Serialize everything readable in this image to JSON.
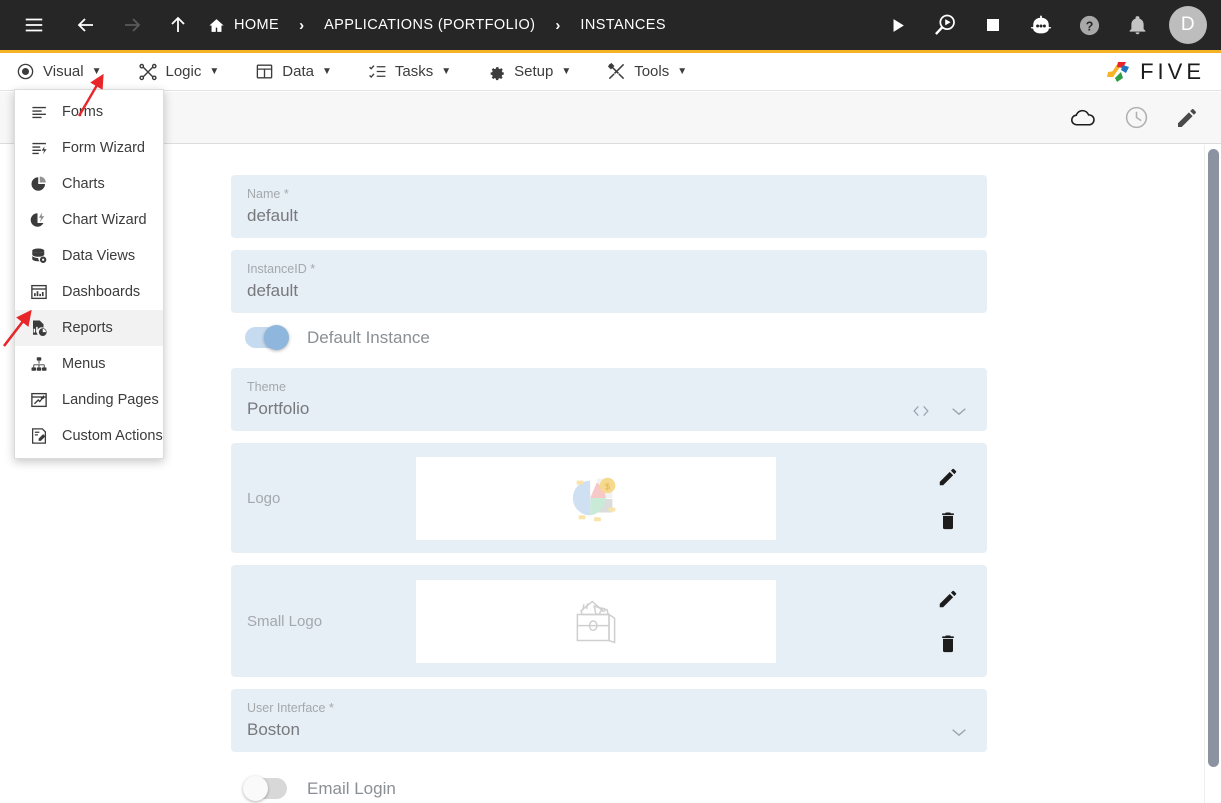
{
  "topbar": {
    "menu_icon": "hamburger-icon",
    "back_icon": "arrow-left-icon",
    "forward_icon": "arrow-right-icon",
    "up_icon": "arrow-up-icon",
    "breadcrumbs": [
      {
        "label": "HOME",
        "icon": "home-icon"
      },
      {
        "label": "APPLICATIONS (PORTFOLIO)",
        "icon": ""
      },
      {
        "label": "INSTANCES",
        "icon": ""
      }
    ],
    "separator": "›",
    "actions": [
      {
        "name": "run-icon"
      },
      {
        "name": "debug-icon"
      },
      {
        "name": "stop-icon"
      },
      {
        "name": "bot-icon"
      },
      {
        "name": "help-icon"
      },
      {
        "name": "notifications-icon"
      }
    ],
    "avatar_initial": "D",
    "background": "#262626",
    "accent_rule": "#f5b325"
  },
  "menubar": {
    "items": [
      {
        "label": "Visual",
        "icon": "eye-icon",
        "caret": "▼"
      },
      {
        "label": "Logic",
        "icon": "logic-icon",
        "caret": "▼"
      },
      {
        "label": "Data",
        "icon": "table-icon",
        "caret": "▼"
      },
      {
        "label": "Tasks",
        "icon": "tasks-icon",
        "caret": "▼"
      },
      {
        "label": "Setup",
        "icon": "gear-icon",
        "caret": "▼"
      },
      {
        "label": "Tools",
        "icon": "tools-icon",
        "caret": "▼"
      }
    ],
    "brand": {
      "text": "FIVE",
      "icon": "five-logo-icon"
    }
  },
  "dropdown": {
    "open_for": "Visual",
    "items": [
      {
        "label": "Forms",
        "icon": "forms-icon",
        "hovered": false
      },
      {
        "label": "Form Wizard",
        "icon": "form-wizard-icon",
        "hovered": false
      },
      {
        "label": "Charts",
        "icon": "charts-icon",
        "hovered": false
      },
      {
        "label": "Chart Wizard",
        "icon": "chart-wizard-icon",
        "hovered": false
      },
      {
        "label": "Data Views",
        "icon": "data-views-icon",
        "hovered": false
      },
      {
        "label": "Dashboards",
        "icon": "dashboards-icon",
        "hovered": false
      },
      {
        "label": "Reports",
        "icon": "reports-icon",
        "hovered": true
      },
      {
        "label": "Menus",
        "icon": "menus-icon",
        "hovered": false
      },
      {
        "label": "Landing Pages",
        "icon": "landing-pages-icon",
        "hovered": false
      },
      {
        "label": "Custom Actions",
        "icon": "custom-actions-icon",
        "hovered": false
      }
    ]
  },
  "subtoolbar": {
    "actions": [
      {
        "name": "cloud-icon"
      },
      {
        "name": "history-clock-icon"
      },
      {
        "name": "edit-pencil-icon"
      }
    ]
  },
  "form": {
    "fields": [
      {
        "label": "Name *",
        "value": "default",
        "type": "text"
      },
      {
        "label": "InstanceID *",
        "value": "default",
        "type": "text"
      }
    ],
    "default_instance": {
      "label": "Default Instance",
      "on": true
    },
    "theme": {
      "label": "Theme",
      "value": "Portfolio",
      "code_icon": "‹›",
      "chevron": "chevron-down-icon"
    },
    "logo": {
      "label": "Logo",
      "image": "portfolio-pie-logo",
      "edit": "edit-pencil-icon",
      "delete": "trash-icon"
    },
    "small_logo": {
      "label": "Small Logo",
      "image": "image-placeholder",
      "edit": "edit-pencil-icon",
      "delete": "trash-icon"
    },
    "user_interface": {
      "label": "User Interface *",
      "value": "Boston",
      "chevron": "chevron-down-icon"
    },
    "email_login": {
      "label": "Email Login",
      "on": false
    }
  },
  "annotations": [
    {
      "name": "red-arrow-visual-menu",
      "color": "#e8262a"
    },
    {
      "name": "red-arrow-reports-item",
      "color": "#e8262a"
    }
  ],
  "colors": {
    "field_bg": "#e6eef6",
    "topbar_bg": "#262626",
    "accent_yellow": "#f5b325",
    "annotation_red": "#e8262a"
  }
}
